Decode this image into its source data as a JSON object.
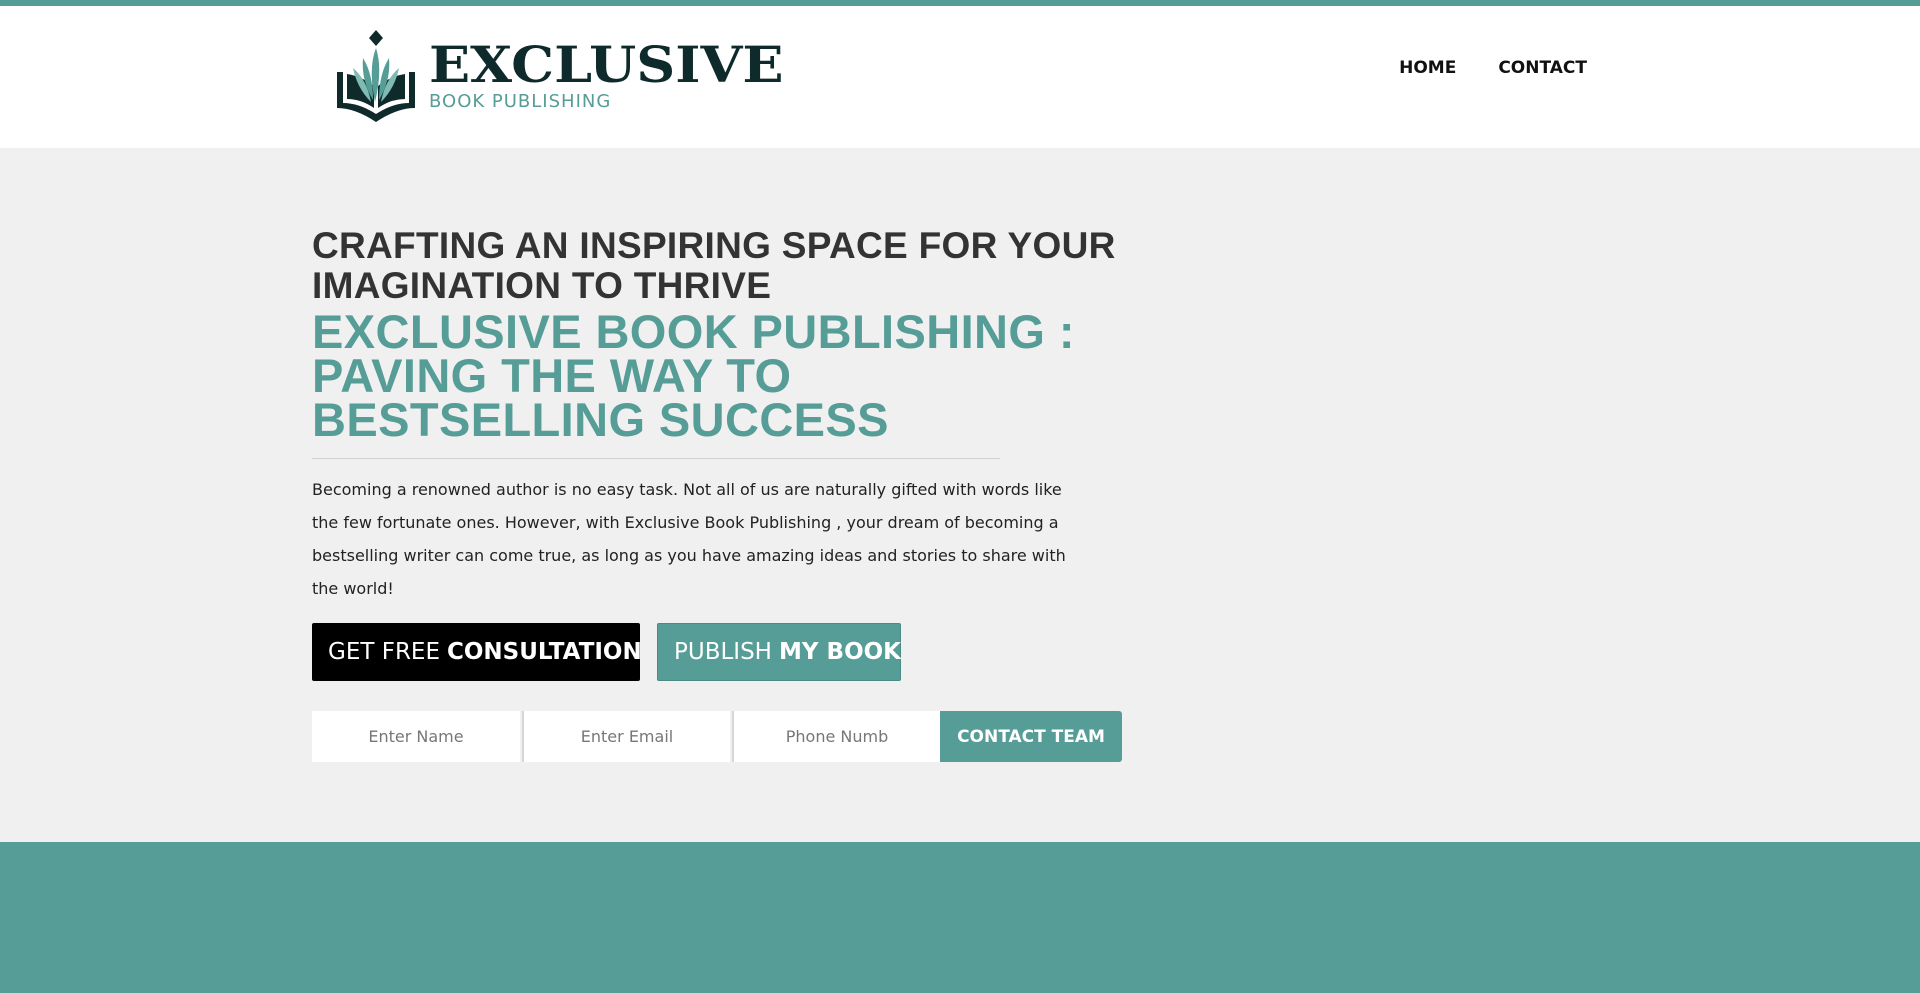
{
  "brand": {
    "name": "EXCLUSIVE",
    "tagline": "BOOK PUBLISHING"
  },
  "nav": {
    "items": [
      {
        "label": "HOME"
      },
      {
        "label": "CONTACT"
      }
    ]
  },
  "hero": {
    "heading_top": "CRAFTING AN INSPIRING SPACE FOR YOUR IMAGINATION TO THRIVE",
    "heading_main": "EXCLUSIVE BOOK PUBLISHING : PAVING THE WAY TO BESTSELLING SUCCESS",
    "description": "Becoming a renowned author is no easy task. Not all of us are naturally gifted with words like the few fortunate ones. However, with Exclusive Book Publishing , your dream of becoming a bestselling writer can come true, as long as you have amazing ideas and stories to share with the world!"
  },
  "buttons": {
    "consult_light": "GET FREE",
    "consult_bold": "CONSULTATION",
    "publish_light": "PUBLISH",
    "publish_bold": "MY BOOK"
  },
  "form": {
    "name_placeholder": "Enter Name",
    "email_placeholder": "Enter Email",
    "phone_placeholder": "Phone Numb",
    "submit_label": "CONTACT TEAM"
  },
  "colors": {
    "accent": "#559d96",
    "dark": "#0e2a2a",
    "background": "#f0f0f0"
  }
}
